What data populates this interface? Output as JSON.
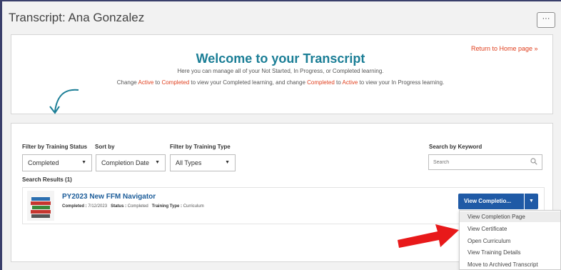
{
  "header": {
    "title": "Transcript: Ana Gonzalez",
    "more_label": "···"
  },
  "welcome": {
    "return_link": "Return to Home page »",
    "title": "Welcome to your Transcript",
    "subtitle": "Here you can manage all of your Not Started, In Progress, or Completed learning.",
    "change_1": "Change ",
    "active_1": "Active",
    "change_2": " to ",
    "completed_1": "Completed",
    "change_3": " to view your Completed learning, and change ",
    "completed_2": "Completed",
    "change_4": " to ",
    "active_2": "Active",
    "change_5": " to view your In Progress learning."
  },
  "filters": {
    "status_label": "Filter by Training Status",
    "status_value": "Completed",
    "sort_label": "Sort by",
    "sort_value": "Completion Date",
    "type_label": "Filter by Training Type",
    "type_value": "All Types",
    "search_label": "Search by Keyword",
    "search_placeholder": "Search"
  },
  "results": {
    "count_label": "Search Results (1)",
    "items": [
      {
        "title": "PY2023 New FFM Navigator",
        "completed_label": "Completed :",
        "completed_value": "7/12/2023",
        "status_label": "Status :",
        "status_value": "Completed",
        "type_label": "Training Type :",
        "type_value": "Curriculum",
        "action_label": "View Completio...",
        "menu": [
          "View Completion Page",
          "View Certificate",
          "Open Curriculum",
          "View Training Details",
          "Move to Archived Transcript"
        ]
      }
    ]
  },
  "colors": {
    "accent_teal": "#1b7e96",
    "accent_red": "#e0401f",
    "button_blue": "#1f5aa6",
    "annotation_arrow": "#e8191a"
  },
  "icons": [
    "curved-arrow-icon",
    "search-icon",
    "book-stack-icon",
    "caret-down-icon",
    "red-pointer-arrow-icon"
  ]
}
